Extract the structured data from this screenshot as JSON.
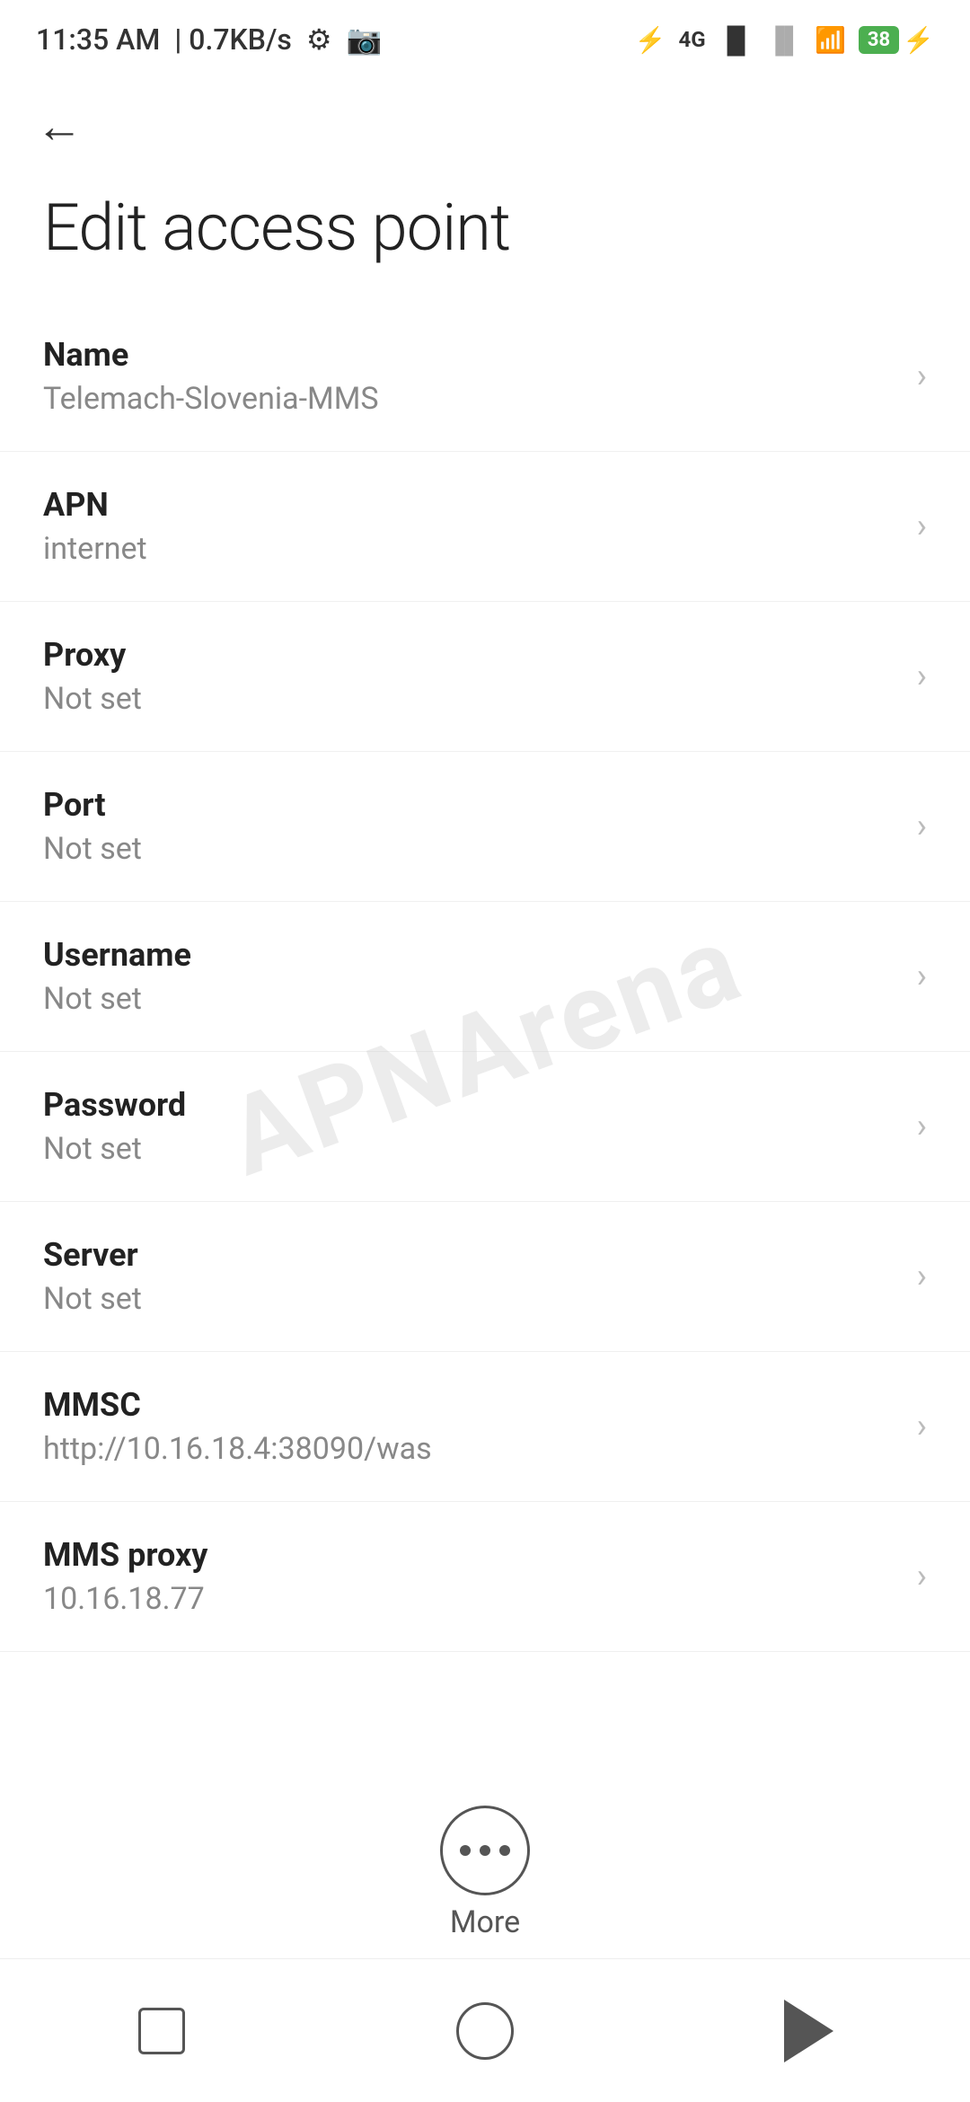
{
  "statusBar": {
    "time": "11:35 AM",
    "speed": "0.7KB/s",
    "battery": "38"
  },
  "header": {
    "backLabel": "←",
    "title": "Edit access point"
  },
  "settings": [
    {
      "label": "Name",
      "value": "Telemach-Slovenia-MMS"
    },
    {
      "label": "APN",
      "value": "internet"
    },
    {
      "label": "Proxy",
      "value": "Not set"
    },
    {
      "label": "Port",
      "value": "Not set"
    },
    {
      "label": "Username",
      "value": "Not set"
    },
    {
      "label": "Password",
      "value": "Not set"
    },
    {
      "label": "Server",
      "value": "Not set"
    },
    {
      "label": "MMSC",
      "value": "http://10.16.18.4:38090/was"
    },
    {
      "label": "MMS proxy",
      "value": "10.16.18.77"
    }
  ],
  "bottomBar": {
    "moreLabel": "More"
  },
  "watermark": {
    "text": "APNArena"
  }
}
